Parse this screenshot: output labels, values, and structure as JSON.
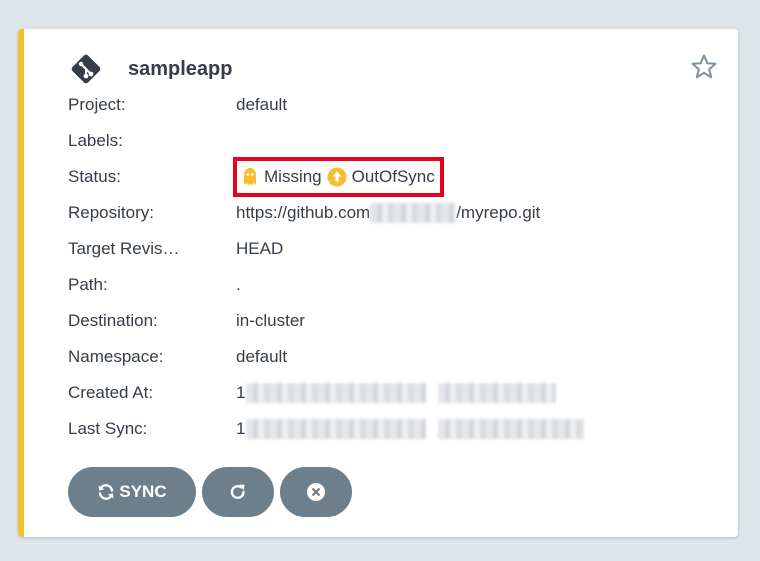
{
  "app": {
    "name": "sampleapp",
    "accent_color": "#f4c030"
  },
  "fields": {
    "project": {
      "label": "Project:",
      "value": "default"
    },
    "labels": {
      "label": "Labels:",
      "value": ""
    },
    "status": {
      "label": "Status:",
      "health": "Missing",
      "sync": "OutOfSync",
      "health_color": "#f4c030",
      "sync_color": "#f4c030",
      "highlight_color": "#e8001c"
    },
    "repository": {
      "label": "Repository:",
      "prefix": "https://github.com",
      "suffix": "/myrepo.git"
    },
    "target_revision": {
      "label": "Target Revis…",
      "value": "HEAD"
    },
    "path": {
      "label": "Path:",
      "value": "."
    },
    "destination": {
      "label": "Destination:",
      "value": "in-cluster"
    },
    "namespace": {
      "label": "Namespace:",
      "value": "default"
    },
    "created_at": {
      "label": "Created At:",
      "value_prefix": "1"
    },
    "last_sync": {
      "label": "Last Sync:",
      "value_prefix": "1"
    }
  },
  "actions": {
    "sync_label": "SYNC"
  },
  "icons": {
    "app": "git-icon",
    "favorite": "star-outline-icon",
    "health": "ghost-icon",
    "sync_status": "arrow-up-circle-icon",
    "sync_button": "sync-icon",
    "refresh_button": "redo-icon",
    "delete_button": "times-circle-icon"
  }
}
